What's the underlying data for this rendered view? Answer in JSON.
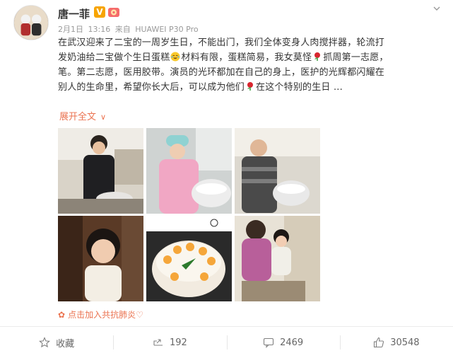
{
  "post": {
    "username": "唐一菲",
    "v_badge": "V",
    "meta": {
      "date": "2月1日",
      "time": "13:16",
      "source_prefix": "来自",
      "source": "HUAWEI P30 Pro"
    },
    "content_lines": [
      "在武汉迎来了二宝的一周岁生日，不能出门，我们全体变身人肉搅拌器，轮流打",
      "发奶油给二宝做个生日蛋糕",
      "材料有限，蛋糕简易，我女莫怪",
      "抓周第一志愿，",
      "笔。第二志愿，医用胶带。演员的光环都加在自己的身上，医护的光辉都闪耀在",
      "别人的生命里，希望你长大后，可以成为他们",
      "在这个特别的生日 ..."
    ],
    "expand_label": "展开全文",
    "expand_chevron": "∨",
    "tag_text": "点击加入共抗肺炎♡"
  },
  "actions": [
    {
      "label": "收藏",
      "icon": "star-icon"
    },
    {
      "label": "192",
      "icon": "share-icon"
    },
    {
      "label": "2469",
      "icon": "comment-icon"
    },
    {
      "label": "30548",
      "icon": "thumbs-up-icon"
    }
  ],
  "colors": {
    "accent": "#eb7350",
    "badge": "#f7a400",
    "meta_gray": "#999999"
  }
}
